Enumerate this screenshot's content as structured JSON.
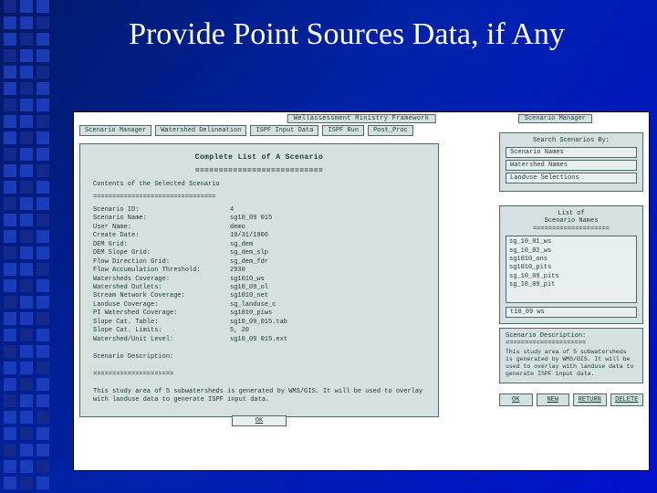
{
  "slide": {
    "title": "Provide Point Sources Data, if Any"
  },
  "app": {
    "window_title": "Wellassessment Ministry Framework",
    "side_label": "Scenario Manager",
    "tabs": [
      "Scenario Manager",
      "Watershed Delineation",
      "ISPF Input Data",
      "ISPF Run",
      "Post_Proc"
    ],
    "close_x": "×"
  },
  "left_panel": {
    "heading": "Complete List of A Scenario",
    "rule": "===========================",
    "sub": "Contents of the Selected Scenario",
    "sub_rule": "================================",
    "rows": [
      {
        "k": "Scenario ID:",
        "v": "4"
      },
      {
        "k": "Scenario Name:",
        "v": "sg10_09 015"
      },
      {
        "k": "User Name:",
        "v": "demo"
      },
      {
        "k": "Create Date:",
        "v": "10/31/1906"
      },
      {
        "k": "DEM Grid:",
        "v": "sg_dem"
      },
      {
        "k": "DEM Slope Grid:",
        "v": "sg_dem_slp"
      },
      {
        "k": "Flow Direction Grid:",
        "v": "sg_dem_fdr"
      },
      {
        "k": "Flow Accumulation Threshold:",
        "v": "2930"
      },
      {
        "k": "Watersheds Coverage:",
        "v": "sg1010_ws"
      },
      {
        "k": "Watershed Outlets:",
        "v": "sg10_09_ol"
      },
      {
        "k": "Stream Network Coverage:",
        "v": "sg1010_net"
      },
      {
        "k": "Landuse Coverage:",
        "v": "sg_landuse_c"
      },
      {
        "k": "PI Watershed Coverage:",
        "v": "sg1010_piws"
      },
      {
        "k": "Slope Cat. Table:",
        "v": "sg10_09_015.tab"
      },
      {
        "k": "Slope Cat. Limits:",
        "v": "5, 20"
      },
      {
        "k": "Watershed/Unit Level:",
        "v": "sg10_09 015.ext"
      }
    ],
    "desc_heading": "Scenario Description:",
    "desc_rule": "=====================",
    "desc_body": "This study area of 5 subwatersheds is generated by WMS/GIS. It will be used to overlay with landuse data to generate ISPF input data.",
    "ok": "OK"
  },
  "search_box": {
    "heading": "Search Scenarios By:",
    "items": [
      "Scenario Names",
      "Watershed Names",
      "Landuse Selections"
    ]
  },
  "scenario_list": {
    "heading_l1": "List of",
    "heading_l2": "Scenario Names",
    "rule": "====================",
    "items": [
      "sg_10_01_ws",
      "sg_10_02_ws",
      "sg1010_ons",
      "sg1010_pits",
      "sg_10_09_pits",
      "sg_10_09_pit"
    ],
    "extra": "t10_09 ws"
  },
  "desc_box": {
    "heading": "Scenario Description:",
    "rule": "=====================",
    "body": "This study area of 5 subwatersheds is generated by WMS/GIS. It will be used to overlay with landuse data to generate ISPF input data."
  },
  "buttons": {
    "ok": "OK",
    "new": "NEW",
    "ret": "RETURN",
    "del": "DELETE"
  }
}
